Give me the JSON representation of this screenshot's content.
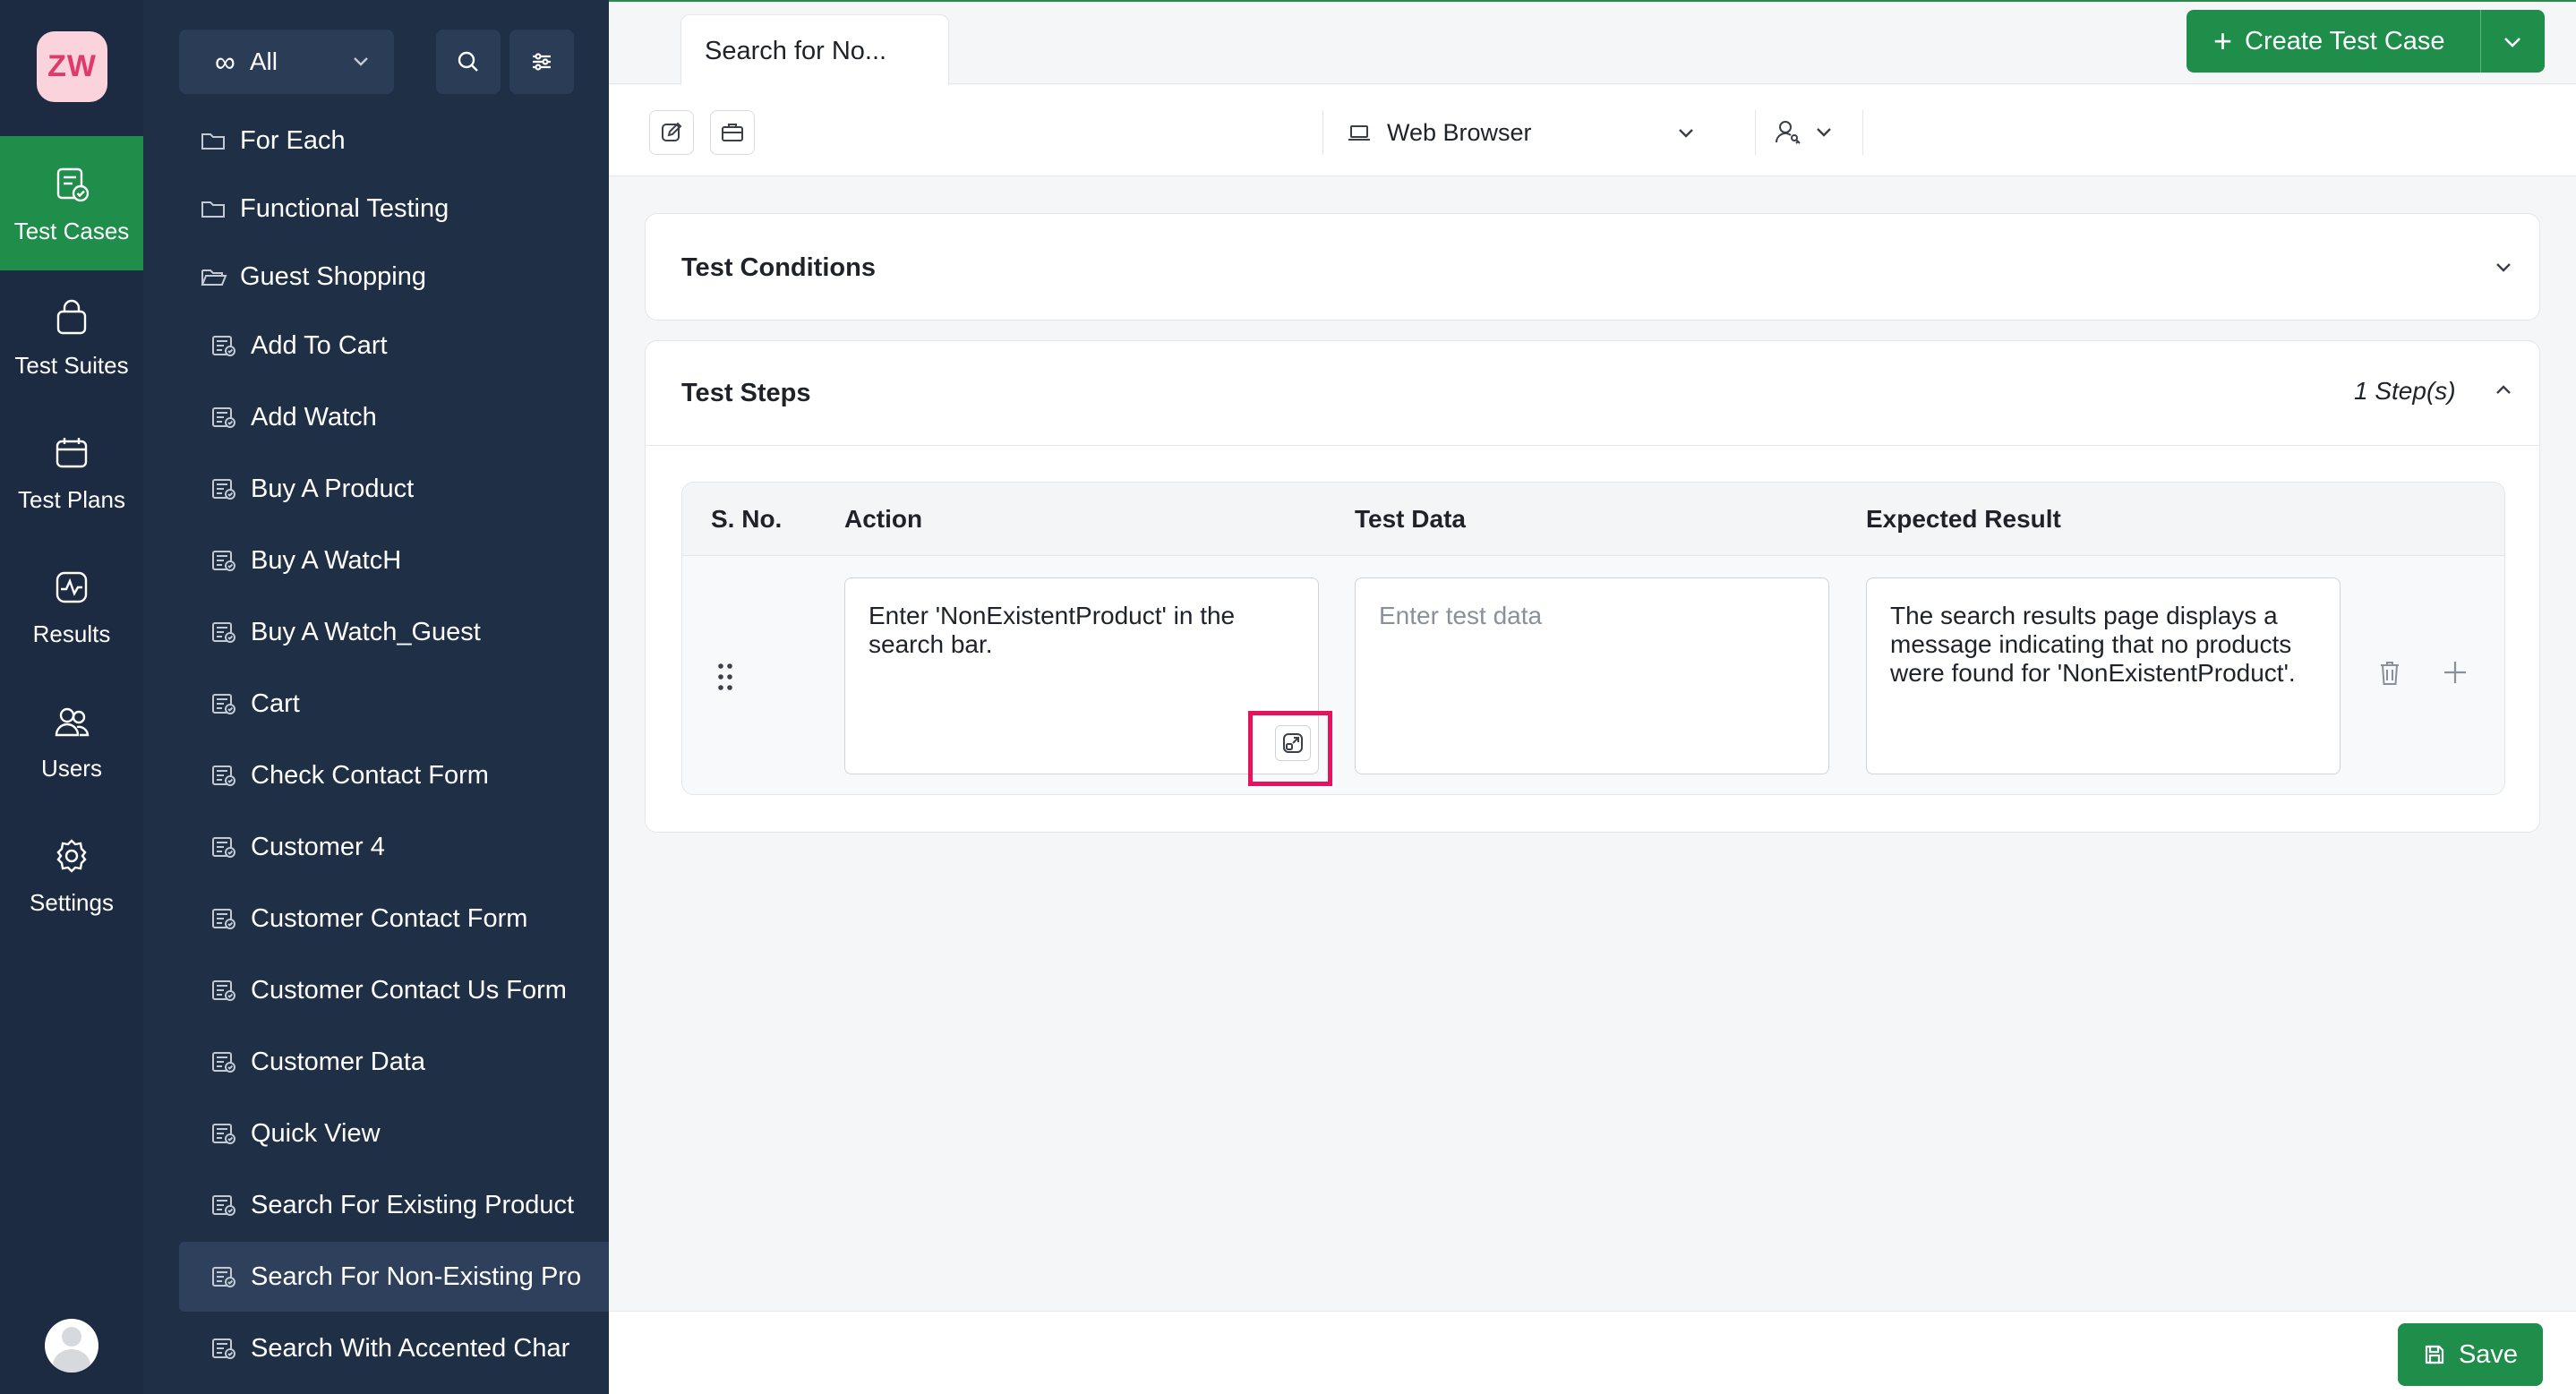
{
  "app": {
    "logo_text": "ZW"
  },
  "rail": {
    "items": [
      {
        "label": "Test Cases",
        "icon": "test-cases-icon",
        "active": true
      },
      {
        "label": "Test Suites",
        "icon": "test-suites-icon"
      },
      {
        "label": "Test Plans",
        "icon": "test-plans-icon"
      },
      {
        "label": "Results",
        "icon": "results-icon"
      },
      {
        "label": "Users",
        "icon": "users-icon"
      },
      {
        "label": "Settings",
        "icon": "settings-icon"
      }
    ]
  },
  "tree": {
    "filter_label": "All",
    "folders": [
      "For Each",
      "Functional Testing",
      "Guest Shopping"
    ],
    "cases": [
      "Add To Cart",
      "Add Watch",
      "Buy A Product",
      "Buy A WatcH",
      "Buy A Watch_Guest",
      "Cart",
      "Check Contact Form",
      "Customer 4",
      "Customer Contact Form",
      "Customer Contact Us Form",
      "Customer Data",
      "Quick View",
      "Search For Existing Product",
      "Search For Non-Existing Pro",
      "Search With Accented Char"
    ],
    "selected": "Search For Non-Existing Pro"
  },
  "header": {
    "tab_label": "Search for No...",
    "create_button": "Create Test Case"
  },
  "toolbar": {
    "browser_label": "Web Browser"
  },
  "sections": {
    "conditions_title": "Test Conditions",
    "steps_title": "Test Steps",
    "step_count": "1 Step(s)"
  },
  "steps_table": {
    "columns": [
      "S. No.",
      "Action",
      "Test Data",
      "Expected Result"
    ],
    "rows": [
      {
        "action": "Enter 'NonExistentProduct' in the search bar.",
        "test_data_placeholder": "Enter test data",
        "expected": "The search results page displays a message indicating that no products were found for 'NonExistentProduct'."
      }
    ]
  },
  "footer": {
    "save_label": "Save"
  },
  "colors": {
    "accent": "#1e8e4a",
    "sidebar": "#1e2f46",
    "rail": "#1c2b41",
    "highlight": "#e5135d"
  }
}
